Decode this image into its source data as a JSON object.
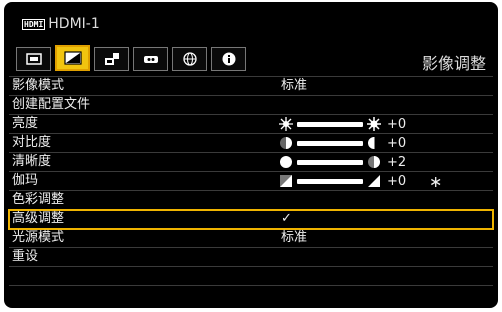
{
  "header": {
    "hdmi_logo": "HDMI",
    "source": "HDMI-1",
    "menu_title": "影像调整"
  },
  "tabs": [
    {
      "icon": "screen-icon"
    },
    {
      "icon": "image-adjust-icon",
      "active": true
    },
    {
      "icon": "setup-icon"
    },
    {
      "icon": "system-icon"
    },
    {
      "icon": "network-icon"
    },
    {
      "icon": "info-icon"
    }
  ],
  "rows": {
    "image_mode": {
      "label": "影像模式",
      "value": "标准"
    },
    "create_profile": {
      "label": "创建配置文件"
    },
    "brightness": {
      "label": "亮度",
      "value": "+0"
    },
    "contrast": {
      "label": "对比度",
      "value": "+0"
    },
    "sharpness": {
      "label": "清晰度",
      "value": "+2"
    },
    "gamma": {
      "label": "伽玛",
      "value": "+0",
      "mark": "∗"
    },
    "color_adjust": {
      "label": "色彩调整"
    },
    "advanced": {
      "label": "高级调整",
      "value": "✓"
    },
    "light_mode": {
      "label": "光源模式",
      "value": "标准"
    },
    "reset": {
      "label": "重设"
    }
  },
  "colors": {
    "accent": "#f1c40f",
    "selection_border": "#f0b400",
    "background": "#000000",
    "text": "#eeeeee"
  }
}
